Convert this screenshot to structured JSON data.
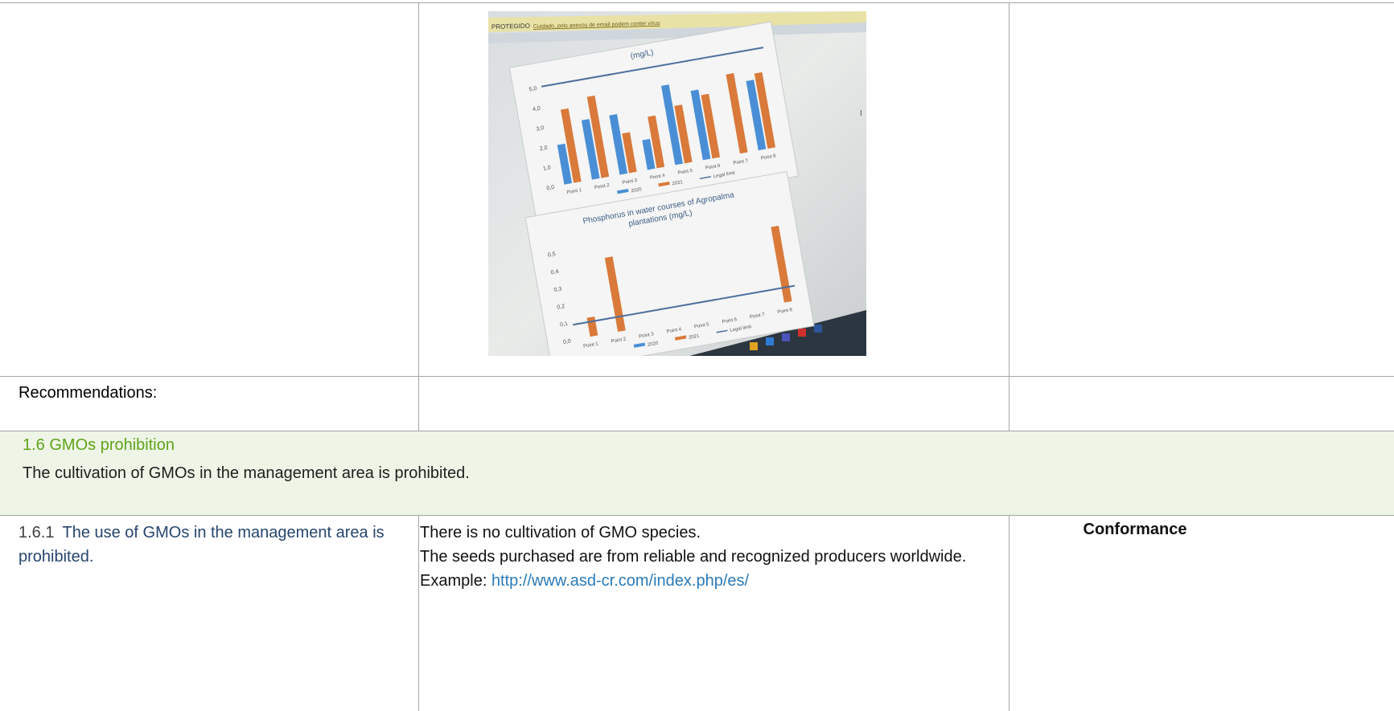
{
  "photo": {
    "banner_label": "PROTEGIDO",
    "banner_warning": "Cuidado, pois anexos de email podem conter vírus",
    "chart1_unit": "(mg/L)",
    "chart2_title_line1": "Phosphorus in water courses of Agropalma",
    "chart2_title_line2": "plantations (mg/L)",
    "colors": {
      "series_2020": "#4a8fd6",
      "series_2021": "#d9793a",
      "legal_limit": "#4d6f9e"
    }
  },
  "chart_data": [
    {
      "type": "bar",
      "title": "(mg/L)",
      "categories": [
        "Point 1",
        "Point 2",
        "Point 3",
        "Point 4",
        "Point 5",
        "Point 6",
        "Point 7",
        "Point 8"
      ],
      "series": [
        {
          "name": "2020",
          "values": [
            2.0,
            3.0,
            3.0,
            1.5,
            4.0,
            3.5,
            0,
            3.5
          ]
        },
        {
          "name": "2021",
          "values": [
            3.7,
            4.1,
            2.0,
            2.6,
            2.9,
            3.2,
            4.0,
            3.8
          ]
        },
        {
          "name": "Legal limit",
          "values": [
            5.0,
            5.0,
            5.0,
            5.0,
            5.0,
            5.0,
            5.0,
            5.0
          ]
        }
      ],
      "yticks": [
        "0,0",
        "1,0",
        "2,0",
        "3,0",
        "4,0",
        "5,0"
      ],
      "ylim": [
        0,
        5
      ]
    },
    {
      "type": "bar",
      "title": "Phosphorus in water courses of Agropalma plantations (mg/L)",
      "categories": [
        "Point 1",
        "Point 2",
        "Point 3",
        "Point 4",
        "Point 5",
        "Point 6",
        "Point 7",
        "Point 8"
      ],
      "series": [
        {
          "name": "2020",
          "values": [
            0,
            0,
            0,
            0,
            0,
            0,
            0,
            0
          ]
        },
        {
          "name": "2021",
          "values": [
            0.13,
            0.51,
            0,
            0,
            0,
            0,
            0,
            0.52
          ]
        },
        {
          "name": "Legal limit",
          "values": [
            0.1,
            0.1,
            0.1,
            0.1,
            0.1,
            0.1,
            0.1,
            0.1
          ]
        }
      ],
      "yticks": [
        "0,0",
        "0,1",
        "0,2",
        "0,3",
        "0,4",
        "0,5"
      ],
      "ylim": [
        0,
        0.6
      ]
    }
  ],
  "table": {
    "recommendations_label": "Recommendations:",
    "section": {
      "title": "1.6  GMOs prohibition",
      "description": "The cultivation of GMOs in the management area is prohibited."
    },
    "requirement": {
      "number": "1.6.1",
      "text": "The use of GMOs in the management area is prohibited.",
      "evidence_line1": "There is no cultivation of GMO species.",
      "evidence_line2": "The seeds purchased are from reliable and recognized producers worldwide.",
      "example_label": "Example:",
      "example_link": "http://www.asd-cr.com/index.php/es/",
      "verdict": "Conformance"
    }
  }
}
